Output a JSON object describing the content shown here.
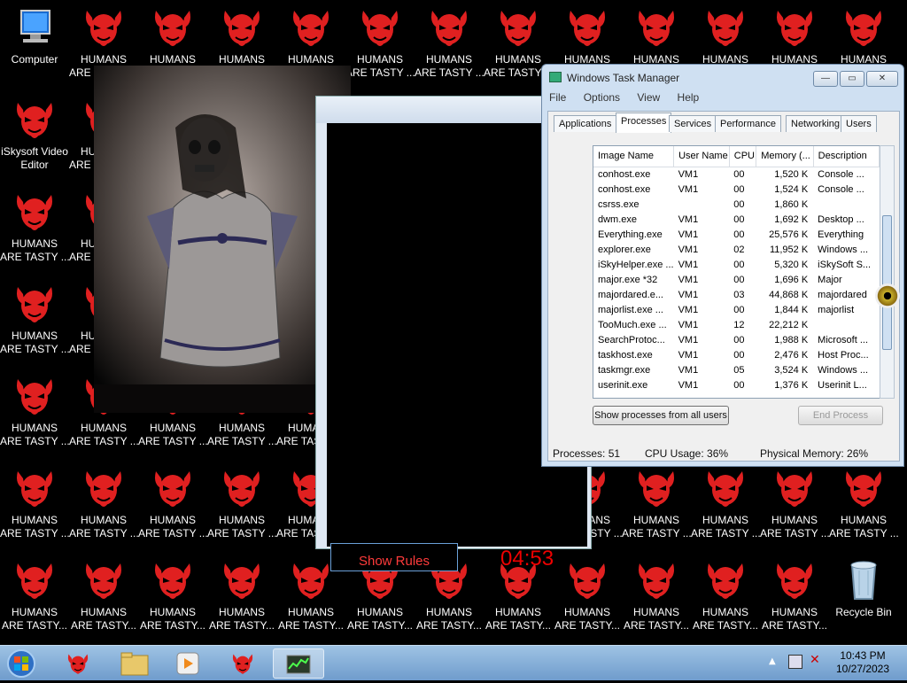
{
  "desktop": {
    "computer_label": "Computer",
    "iskysoft_label_line1": "iSkysoft Video",
    "iskysoft_label_line2": "Editor",
    "humans_line1": "HUMANS",
    "humans_line2": "ARE TASTY ...",
    "humans_line2_alt": "ARE TASTY...",
    "recycle_label": "Recycle Bin",
    "devil_color": "#e02020"
  },
  "game": {
    "show_rules_label": "Show Rules",
    "timer": "04:53"
  },
  "task_manager": {
    "title": "Windows Task Manager",
    "menu": [
      "File",
      "Options",
      "View",
      "Help"
    ],
    "tabs": [
      "Applications",
      "Processes",
      "Services",
      "Performance",
      "Networking",
      "Users"
    ],
    "active_tab": "Processes",
    "columns": [
      "Image Name",
      "User Name",
      "CPU",
      "Memory (...",
      "Description"
    ],
    "rows": [
      {
        "name": "conhost.exe",
        "user": "VM1",
        "cpu": "00",
        "mem": "1,520 K",
        "desc": "Console ..."
      },
      {
        "name": "conhost.exe",
        "user": "VM1",
        "cpu": "00",
        "mem": "1,524 K",
        "desc": "Console ..."
      },
      {
        "name": "csrss.exe",
        "user": "",
        "cpu": "00",
        "mem": "1,860 K",
        "desc": ""
      },
      {
        "name": "dwm.exe",
        "user": "VM1",
        "cpu": "00",
        "mem": "1,692 K",
        "desc": "Desktop ..."
      },
      {
        "name": "Everything.exe",
        "user": "VM1",
        "cpu": "00",
        "mem": "25,576 K",
        "desc": "Everything"
      },
      {
        "name": "explorer.exe",
        "user": "VM1",
        "cpu": "02",
        "mem": "11,952 K",
        "desc": "Windows ..."
      },
      {
        "name": "iSkyHelper.exe ...",
        "user": "VM1",
        "cpu": "00",
        "mem": "5,320 K",
        "desc": "iSkySoft S..."
      },
      {
        "name": "major.exe *32",
        "user": "VM1",
        "cpu": "00",
        "mem": "1,696 K",
        "desc": "Major"
      },
      {
        "name": "majordared.e...",
        "user": "VM1",
        "cpu": "03",
        "mem": "44,868 K",
        "desc": "majordared"
      },
      {
        "name": "majorlist.exe ...",
        "user": "VM1",
        "cpu": "00",
        "mem": "1,844 K",
        "desc": "majorlist"
      },
      {
        "name": "TooMuch.exe ...",
        "user": "VM1",
        "cpu": "12",
        "mem": "22,212 K",
        "desc": ""
      },
      {
        "name": "SearchProtoc...",
        "user": "VM1",
        "cpu": "00",
        "mem": "1,988 K",
        "desc": "Microsoft ..."
      },
      {
        "name": "taskhost.exe",
        "user": "VM1",
        "cpu": "00",
        "mem": "2,476 K",
        "desc": "Host Proc..."
      },
      {
        "name": "taskmgr.exe",
        "user": "VM1",
        "cpu": "05",
        "mem": "3,524 K",
        "desc": "Windows ..."
      },
      {
        "name": "userinit.exe",
        "user": "VM1",
        "cpu": "00",
        "mem": "1,376 K",
        "desc": "Userinit L..."
      }
    ],
    "show_all_label": "Show processes from all users",
    "end_process_label": "End Process",
    "status_processes": "Processes: 51",
    "status_cpu": "CPU Usage: 36%",
    "status_memory": "Physical Memory: 26%"
  },
  "taskbar": {
    "time": "10:43 PM",
    "date": "10/27/2023"
  }
}
